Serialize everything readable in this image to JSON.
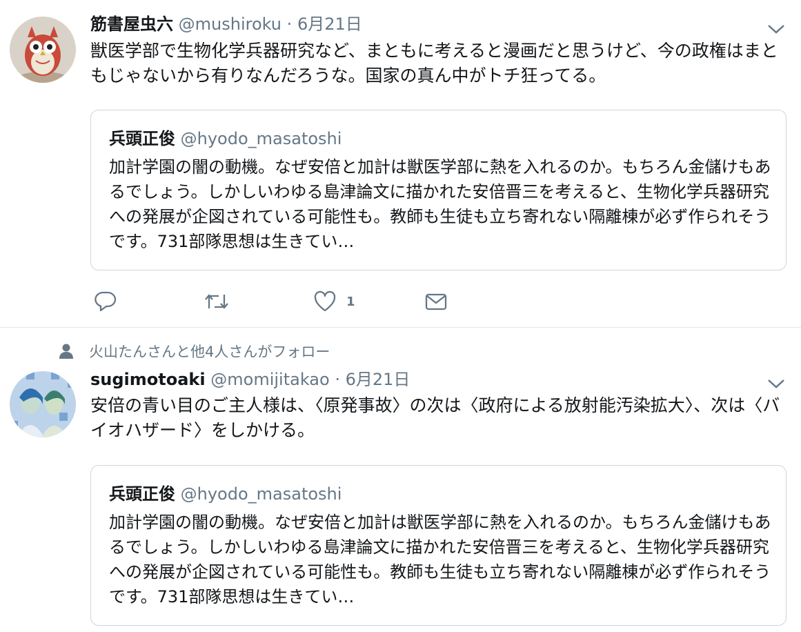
{
  "tweets": [
    {
      "name": "筋書屋虫六",
      "handle": "@mushiroku",
      "separator": "·",
      "date": "6月21日",
      "text": "獣医学部で生物化学兵器研究など、まともに考えると漫画だと思うけど、今の政権はまともじゃないから有りなんだろうな。国家の真ん中がトチ狂ってる。",
      "quote": {
        "name": "兵頭正俊",
        "handle": "@hyodo_masatoshi",
        "text": "加計学園の闇の動機。なぜ安倍と加計は獣医学部に熱を入れるのか。もちろん金儲けもあるでしょう。しかしいわゆる島津論文に描かれた安倍晋三を考えると、生物化学兵器研究への発展が企図されている可能性も。教師も生徒も立ち寄れない隔離棟が必ず作られそうです。731部隊思想は生きてい…"
      },
      "actions": {
        "like_count": "1"
      },
      "icons": [
        "reply-icon",
        "retweet-icon",
        "heart-icon",
        "message-icon",
        "chevron-down-icon"
      ]
    },
    {
      "social_context": "火山たんさんと他4人さんがフォロー",
      "name": "sugimotoaki",
      "handle": "@momijitakao",
      "separator": "·",
      "date": "6月21日",
      "text": "安倍の青い目のご主人様は、〈原発事故〉の次は〈政府による放射能汚染拡大〉、次は〈バイオハザード〉をしかける。",
      "quote": {
        "name": "兵頭正俊",
        "handle": "@hyodo_masatoshi",
        "text": "加計学園の闇の動機。なぜ安倍と加計は獣医学部に熱を入れるのか。もちろん金儲けもあるでしょう。しかしいわゆる島津論文に描かれた安倍晋三を考えると、生物化学兵器研究への発展が企図されている可能性も。教師も生徒も立ち寄れない隔離棟が必ず作られそうです。731部隊思想は生きてい…"
      }
    }
  ],
  "colors": {
    "text": "#14171a",
    "secondary": "#657786",
    "border": "#ccd6dd",
    "divider": "#e1e8ed"
  }
}
